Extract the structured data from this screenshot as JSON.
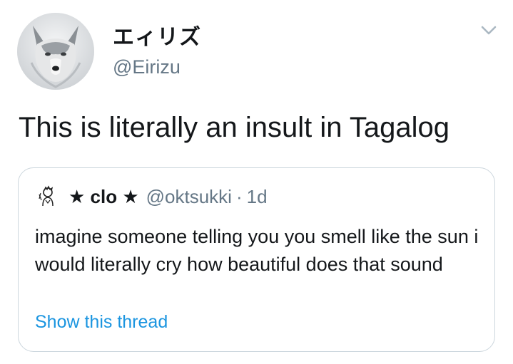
{
  "author": {
    "display_name": "エィリズ",
    "handle": "@Eirizu",
    "avatar_icon": "wolf-avatar-icon"
  },
  "tweet": {
    "text": "This is literally an insult in Tagalog"
  },
  "menu": {
    "icon": "chevron-down-icon"
  },
  "quoted_tweet": {
    "display_name": "★ clo ★",
    "handle": "@oktsukki",
    "separator": "·",
    "time": "1d",
    "avatar_icon": "sketch-avatar-icon",
    "text": "imagine someone telling you you smell like the sun i would literally cry how beautiful does that sound",
    "show_thread_label": "Show this thread"
  },
  "colors": {
    "text_primary": "#14171a",
    "text_secondary": "#657786",
    "link": "#1b95e0",
    "border": "#ccd6dd"
  }
}
